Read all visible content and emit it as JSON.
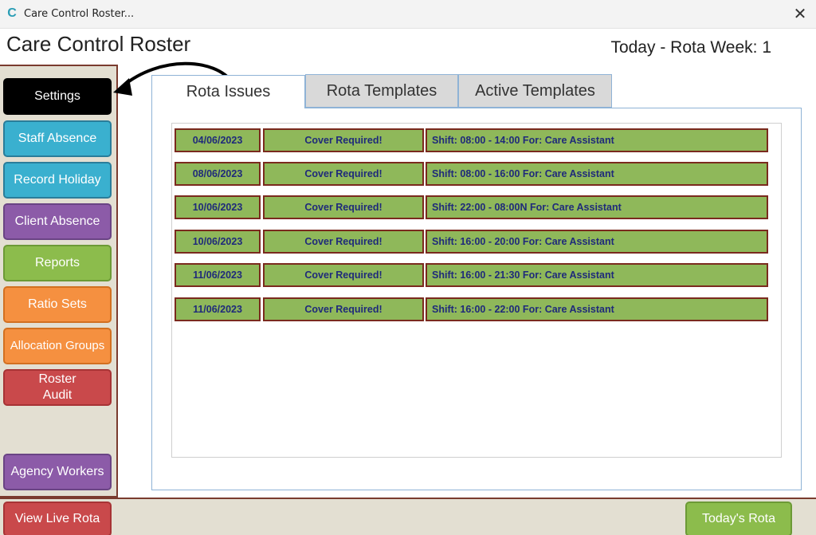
{
  "window": {
    "title": "Care Control Roster...",
    "logo_letter": "C",
    "close_glyph": "✕"
  },
  "header": {
    "app_title": "Care Control Roster",
    "today_info": "Today - Rota Week: 1"
  },
  "sidebar": {
    "items": [
      {
        "label": "Settings",
        "color": "#000000"
      },
      {
        "label": "Staff Absence",
        "color": "#3ab0cf"
      },
      {
        "label": "Record Holiday",
        "color": "#3ab0cf"
      },
      {
        "label": "Client Absence",
        "color": "#8c5ba8"
      },
      {
        "label": "Reports",
        "color": "#8cbc4c"
      },
      {
        "label": "Ratio Sets",
        "color": "#f59040"
      },
      {
        "label": "Allocation Groups",
        "color": "#f59040"
      },
      {
        "label": "Roster\nAudit",
        "color": "#c9494b"
      },
      {
        "label": "Agency Workers",
        "color": "#8c5ba8"
      }
    ]
  },
  "tabs": [
    {
      "label": "Rota Issues",
      "active": true
    },
    {
      "label": "Rota Templates",
      "active": false
    },
    {
      "label": "Active Templates",
      "active": false
    }
  ],
  "issues": [
    {
      "date": "04/06/2023",
      "status": "Cover Required!",
      "description": "Shift: 08:00 - 14:00 For: Care Assistant"
    },
    {
      "date": "08/06/2023",
      "status": "Cover Required!",
      "description": "Shift: 08:00 - 16:00 For: Care Assistant"
    },
    {
      "date": "10/06/2023",
      "status": "Cover Required!",
      "description": "Shift: 22:00 - 08:00N For: Care Assistant"
    },
    {
      "date": "10/06/2023",
      "status": "Cover Required!",
      "description": "Shift: 16:00 - 20:00 For: Care Assistant"
    },
    {
      "date": "11/06/2023",
      "status": "Cover Required!",
      "description": "Shift: 16:00 - 21:30 For: Care Assistant"
    },
    {
      "date": "11/06/2023",
      "status": "Cover Required!",
      "description": "Shift: 16:00 - 22:00 For: Care Assistant"
    }
  ],
  "bottom": {
    "view_live_rota": "View Live Rota",
    "todays_rota": "Today's Rota"
  },
  "colors": {
    "issue_fill": "#8fb85a",
    "issue_border": "#7a2a1e",
    "issue_text": "#1f2a7a",
    "panel_bg": "#e3dfd2",
    "panel_border": "#7a3b2e"
  },
  "icons": {
    "logo": "app-logo-icon",
    "close": "close-icon",
    "arrow": "curved-arrow-annotation"
  }
}
